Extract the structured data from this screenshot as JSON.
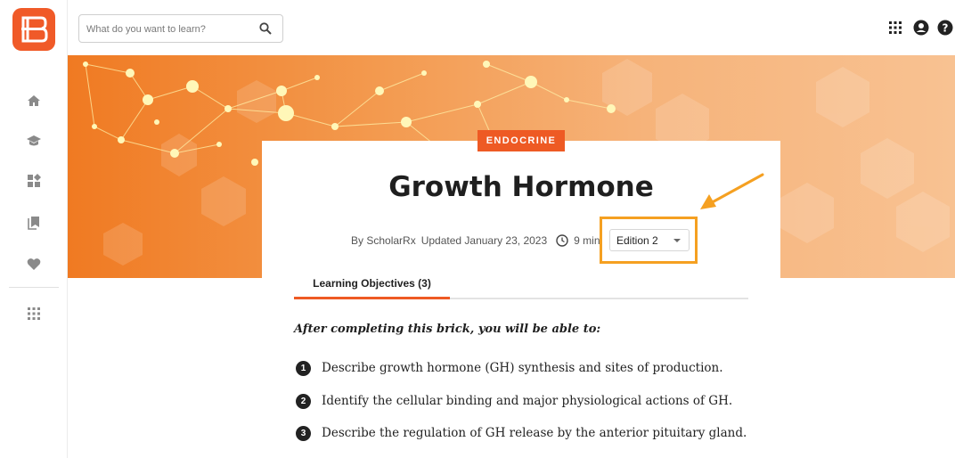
{
  "app": {
    "logo_icon": "scholarrx-logo-icon",
    "accent_color": "#ee5a24",
    "highlight_color": "#f5a021"
  },
  "sidebar": {
    "items": [
      {
        "name": "home-icon"
      },
      {
        "name": "graduation-cap-icon"
      },
      {
        "name": "dashboard-icon"
      },
      {
        "name": "bookmarks-icon"
      },
      {
        "name": "heart-icon"
      },
      {
        "name": "apps-grid-icon"
      }
    ]
  },
  "header": {
    "search": {
      "placeholder": "What do you want to learn?",
      "icon": "search-icon"
    },
    "icons": [
      "apps-grid-icon",
      "account-icon",
      "help-icon"
    ]
  },
  "brick": {
    "topic": "ENDOCRINE",
    "title": "Growth Hormone",
    "author": "By ScholarRx",
    "updated": "Updated January 23, 2023",
    "duration": "9 min",
    "edition": "Edition 2"
  },
  "tabs": [
    {
      "label": "Learning Objectives (3)",
      "active": true
    }
  ],
  "content": {
    "intro": "After completing this brick, you will be able to:",
    "objectives": [
      {
        "num": "1",
        "text": "Describe growth hormone (GH) synthesis and sites of production."
      },
      {
        "num": "2",
        "text": "Identify the cellular binding and major physiological actions of GH."
      },
      {
        "num": "3",
        "text": "Describe the regulation of GH release by the anterior pituitary gland."
      }
    ]
  }
}
